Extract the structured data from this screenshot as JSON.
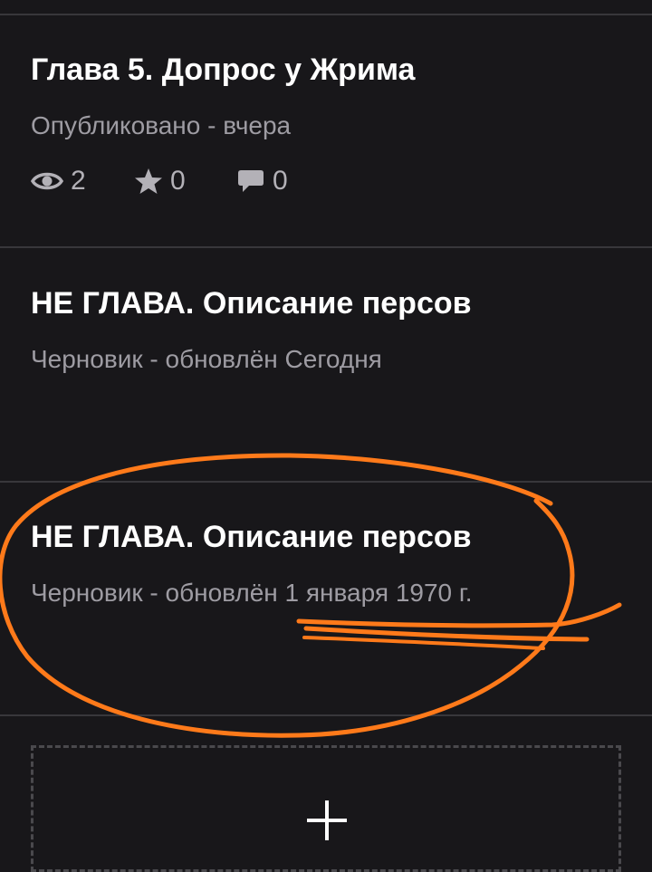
{
  "parts": [
    {
      "title": "Глава 5. Допрос у Жрима",
      "status": "Опубликовано - вчера",
      "stats": {
        "views": "2",
        "stars": "0",
        "comments": "0"
      }
    },
    {
      "title": "НЕ ГЛАВА. Описание персов",
      "status": "Черновик - обновлён Сегодня"
    },
    {
      "title": "НЕ ГЛАВА. Описание персов",
      "status": "Черновик - обновлён 1 января 1970 г."
    }
  ],
  "icons": {
    "views": "eye-icon",
    "stars": "star-icon",
    "comments": "comment-icon",
    "add": "plus-icon"
  },
  "colors": {
    "background": "#18171a",
    "divider": "#38373b",
    "title": "#ffffff",
    "status": "#9e9ca3",
    "stats": "#b3b1b7",
    "annotation": "#ff7a1a"
  }
}
